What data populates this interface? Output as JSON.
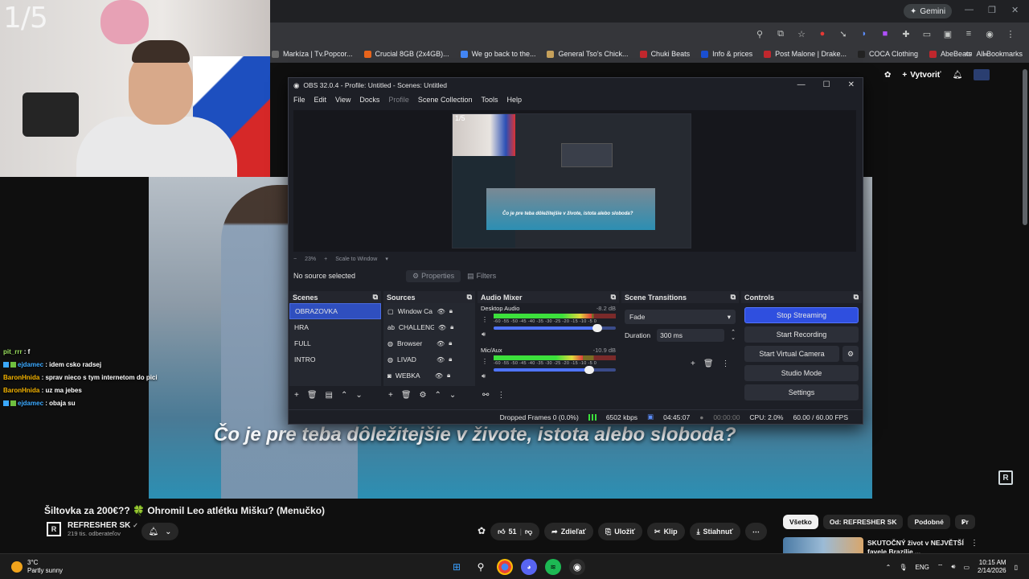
{
  "browser": {
    "gemini_label": "Gemini",
    "bookmarks": [
      {
        "label": "Markíza | Tv.Popcor...",
        "color": "#6b6b6b"
      },
      {
        "label": "Crucial 8GB (2x4GB)...",
        "color": "#e8641b"
      },
      {
        "label": "We go back to the...",
        "color": "#4285f4"
      },
      {
        "label": "General Tso's Chick...",
        "color": "#c6a15b"
      },
      {
        "label": "Chuki Beats",
        "color": "#c0272d"
      },
      {
        "label": "Info & prices",
        "color": "#1a4fd0"
      },
      {
        "label": "Post Malone | Drake...",
        "color": "#c0272d"
      },
      {
        "label": "COCA Clothing",
        "color": "#222222"
      },
      {
        "label": "AbeBeats",
        "color": "#c0272d"
      }
    ],
    "all_bookmarks": "All Bookmarks"
  },
  "youtube_header": {
    "create_label": "Vytvoriť"
  },
  "overlay": {
    "counter": "1/5",
    "chat": [
      {
        "user": "pit_rrr",
        "message": "f",
        "style": "u1",
        "badges": false
      },
      {
        "user": "ejdamec",
        "message": "idem csko radsej",
        "style": "u2",
        "badges": true
      },
      {
        "user": "BaronHnida",
        "message": "sprav nieco s tym internetom do pici",
        "style": "u3",
        "badges": false
      },
      {
        "user": "BaronHnida",
        "message": "uz ma jebes",
        "style": "u3",
        "badges": false
      },
      {
        "user": "ejdamec",
        "message": "obaja su",
        "style": "u2",
        "badges": true
      }
    ],
    "subtitle": "Čo je pre teba dôležitejšie v živote, istota alebo sloboda?"
  },
  "obs": {
    "title": "OBS 32.0.4 - Profile: Untitled - Scenes: Untitled",
    "menu": [
      {
        "label": "File",
        "dim": false
      },
      {
        "label": "Edit",
        "dim": false
      },
      {
        "label": "View",
        "dim": false
      },
      {
        "label": "Docks",
        "dim": false
      },
      {
        "label": "Profile",
        "dim": true
      },
      {
        "label": "Scene Collection",
        "dim": false
      },
      {
        "label": "Tools",
        "dim": false
      },
      {
        "label": "Help",
        "dim": false
      }
    ],
    "preview": {
      "counter": "1/5",
      "subtitle": "Čo je pre teba dôležitejšie v živote, istota alebo sloboda?"
    },
    "zoom": {
      "value": "23%",
      "mode": "Scale to Window"
    },
    "no_source": "No source selected",
    "properties_label": "Properties",
    "filters_label": "Filters",
    "scenes": {
      "title": "Scenes",
      "items": [
        "OBRAZOVKA",
        "HRA",
        "FULL",
        "INTRO"
      ],
      "selected_index": 0
    },
    "sources": {
      "title": "Sources",
      "items": [
        {
          "name": "Window Ca",
          "icon": "window-icon"
        },
        {
          "name": "CHALLENGE",
          "icon": "text-icon"
        },
        {
          "name": "Browser",
          "icon": "globe-icon"
        },
        {
          "name": "LIVAD",
          "icon": "globe-icon"
        },
        {
          "name": "WEBKA",
          "icon": "camera-icon"
        }
      ]
    },
    "mixer": {
      "title": "Audio Mixer",
      "channels": [
        {
          "name": "Desktop Audio",
          "db": "-8.2 dB",
          "level": 0.8,
          "volume": 0.85
        },
        {
          "name": "Mic/Aux",
          "db": "-10.9 dB",
          "level": 0.73,
          "volume": 0.78
        }
      ],
      "scale": "-60 -55 -50 -45 -40 -35 -30 -25 -20 -15 -10 -5 0"
    },
    "transitions": {
      "title": "Scene Transitions",
      "selected": "Fade",
      "duration_label": "Duration",
      "duration_value": "300 ms"
    },
    "controls": {
      "title": "Controls",
      "stop_streaming": "Stop Streaming",
      "start_recording": "Start Recording",
      "start_virtual_camera": "Start Virtual Camera",
      "studio_mode": "Studio Mode",
      "settings": "Settings"
    },
    "status": {
      "dropped": "Dropped Frames 0 (0.0%)",
      "bitrate": "6502 kbps",
      "stream_time": "04:45:07",
      "record_time": "00:00:00",
      "cpu": "CPU: 2.0%",
      "fps": "60.00 / 60.00 FPS"
    }
  },
  "youtube": {
    "video_title": "Šiltovka za 200€?? 🍀 Ohromil Leo atlétku Mišku? (Menučko)",
    "channel_name": "REFRESHER SK",
    "channel_logo": "R",
    "subscribers": "219 tis. odberateľov",
    "likes": "51",
    "share": "Zdieľať",
    "save": "Uložiť",
    "clip": "Klip",
    "download": "Stiahnuť",
    "chips": [
      "Všetko",
      "Od: REFRESHER SK",
      "Podobné",
      "Pr"
    ],
    "recommended_title": "SKUTOČNÝ život v NEJVĚTŠÍ favele Brazílie ..."
  },
  "taskbar": {
    "temp": "3°C",
    "weather": "Partly sunny",
    "lang": "ENG",
    "time": "10:15 AM",
    "date": "2/14/2026"
  }
}
